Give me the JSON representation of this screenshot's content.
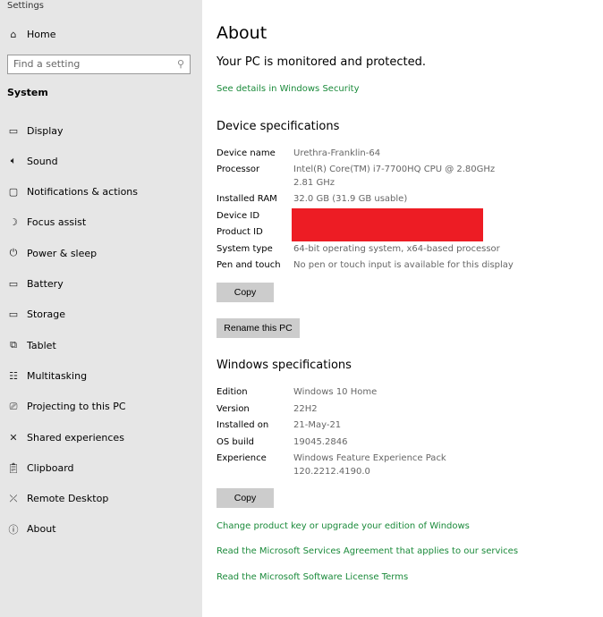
{
  "window": {
    "title": "Settings"
  },
  "sidebar": {
    "home": "Home",
    "search_placeholder": "Find a setting",
    "section": "System",
    "items": [
      {
        "label": "Display",
        "icon": "monitor-icon"
      },
      {
        "label": "Sound",
        "icon": "speaker-icon"
      },
      {
        "label": "Notifications & actions",
        "icon": "notification-icon"
      },
      {
        "label": "Focus assist",
        "icon": "moon-icon"
      },
      {
        "label": "Power & sleep",
        "icon": "power-icon"
      },
      {
        "label": "Battery",
        "icon": "battery-icon"
      },
      {
        "label": "Storage",
        "icon": "storage-icon"
      },
      {
        "label": "Tablet",
        "icon": "tablet-icon"
      },
      {
        "label": "Multitasking",
        "icon": "multitasking-icon"
      },
      {
        "label": "Projecting to this PC",
        "icon": "projecting-icon"
      },
      {
        "label": "Shared experiences",
        "icon": "shared-icon"
      },
      {
        "label": "Clipboard",
        "icon": "clipboard-icon"
      },
      {
        "label": "Remote Desktop",
        "icon": "remote-icon"
      },
      {
        "label": "About",
        "icon": "info-icon"
      }
    ]
  },
  "main": {
    "title": "About",
    "status": "Your PC is monitored and protected.",
    "security_link": "See details in Windows Security",
    "device_heading": "Device specifications",
    "device": [
      {
        "label": "Device name",
        "value": "Urethra-Franklin-64"
      },
      {
        "label": "Processor",
        "value": "Intel(R) Core(TM) i7-7700HQ CPU @ 2.80GHz",
        "value2": "2.81 GHz"
      },
      {
        "label": "Installed RAM",
        "value": "32.0 GB (31.9 GB usable)"
      },
      {
        "label": "Device ID"
      },
      {
        "label": "Product ID"
      },
      {
        "label": "System type",
        "value": "64-bit operating system, x64-based processor"
      },
      {
        "label": "Pen and touch",
        "value": "No pen or touch input is available for this display"
      }
    ],
    "copy": "Copy",
    "rename": "Rename this PC",
    "windows_heading": "Windows specifications",
    "windows": [
      {
        "label": "Edition",
        "value": "Windows 10 Home"
      },
      {
        "label": "Version",
        "value": "22H2"
      },
      {
        "label": "Installed on",
        "value": "21-May-21"
      },
      {
        "label": "OS build",
        "value": "19045.2846"
      },
      {
        "label": "Experience",
        "value": "Windows Feature Experience Pack",
        "value2": "120.2212.4190.0"
      }
    ],
    "links": [
      "Change product key or upgrade your edition of Windows",
      "Read the Microsoft Services Agreement that applies to our services",
      "Read the Microsoft Software License Terms"
    ],
    "colors": {
      "link": "#1a8a3a",
      "redaction": "#ed1c24",
      "sidebar": "#e6e6e6"
    }
  }
}
